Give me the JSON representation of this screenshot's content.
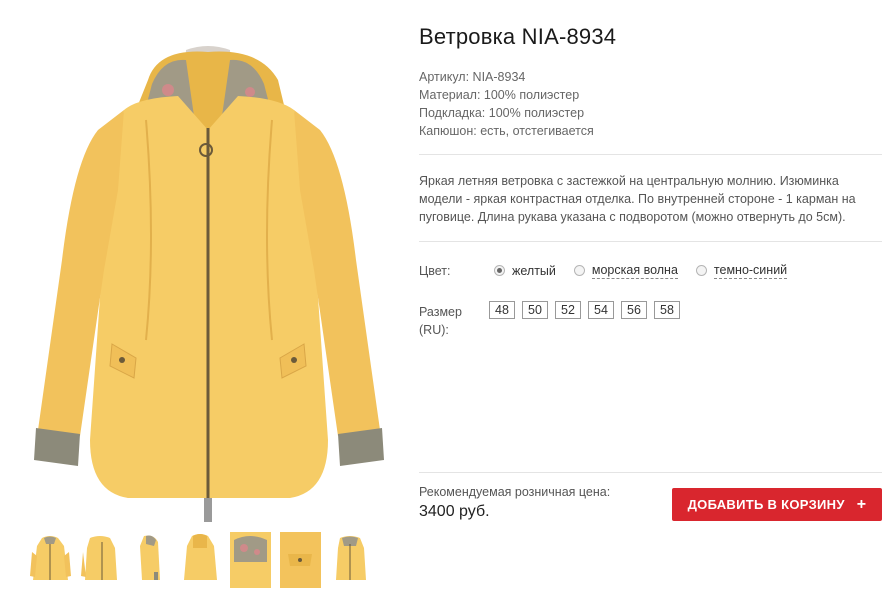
{
  "product": {
    "title": "Ветровка NIA-8934",
    "specs": [
      "Артикул: NIA-8934",
      "Материал: 100% полиэстер",
      "Подкладка: 100% полиэстер",
      "Капюшон: есть, отстегивается"
    ],
    "description": "Яркая летняя ветровка с застежкой на центральную молнию. Изюминка модели - яркая контрастная отделка. По внутренней стороне - 1 карман на пуговице. Длина рукава указана с подворотом (можно отвернуть до 5см).",
    "color_label": "Цвет:",
    "colors": [
      {
        "label": "желтый",
        "selected": true
      },
      {
        "label": "морская волна",
        "selected": false
      },
      {
        "label": "темно-синий",
        "selected": false
      }
    ],
    "size_label_line1": "Размер",
    "size_label_line2": "(RU):",
    "sizes": [
      "48",
      "50",
      "52",
      "54",
      "56",
      "58"
    ],
    "price_label": "Рекомендуемая розничная цена:",
    "price": "3400 руб.",
    "cart_button": "ДОБАВИТЬ В КОРЗИНУ",
    "cart_icon": "plus-icon"
  },
  "gallery": {
    "main_image": "yellow-windbreaker-front",
    "thumbnails": [
      "front",
      "three-quarter",
      "side",
      "back",
      "hood-detail",
      "pocket-detail",
      "lining-detail"
    ],
    "colors": {
      "jacket": "#f6cc66",
      "jacket_shade": "#e9b64a",
      "trim": "#8c8a7a",
      "accent": "#d9262e"
    }
  }
}
